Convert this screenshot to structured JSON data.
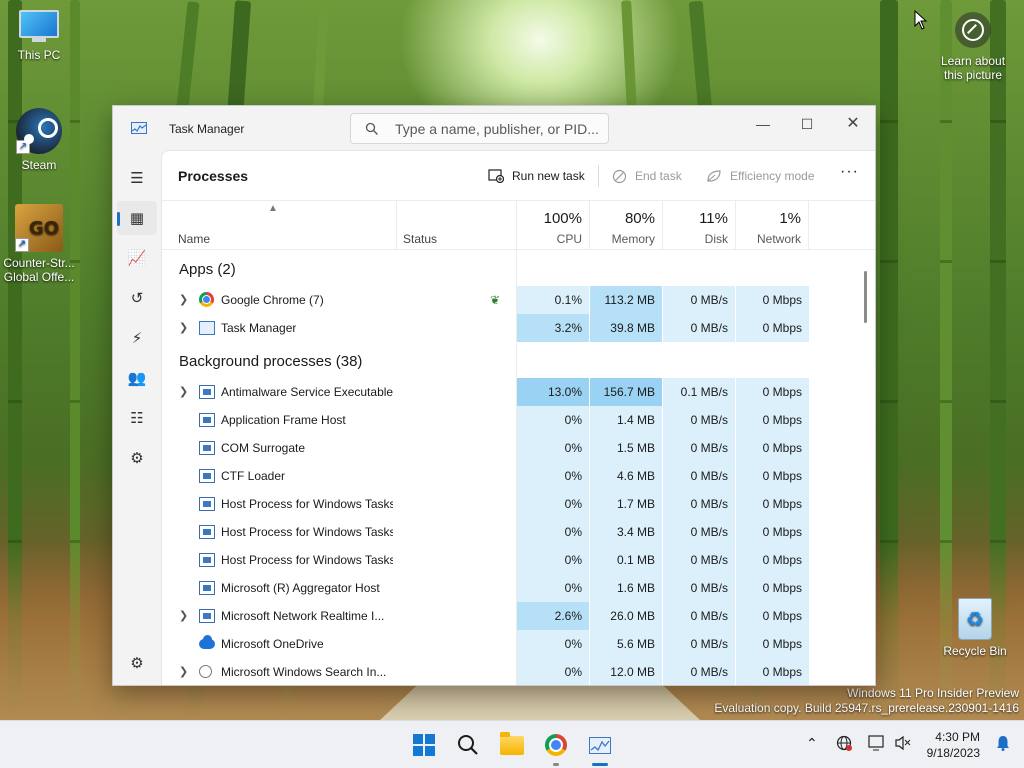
{
  "desktop": {
    "icons": [
      {
        "label": "This PC"
      },
      {
        "label": "Steam"
      },
      {
        "label": "Counter-Str... Global Offe..."
      },
      {
        "label": "Recycle Bin"
      }
    ],
    "cs_logo_text": "GO",
    "learn_label": "Learn about this picture",
    "watermark": {
      "line1": "Windows 11 Pro Insider Preview",
      "line2": "Evaluation copy. Build 25947.rs_prerelease.230901-1416"
    }
  },
  "window": {
    "title": "Task Manager",
    "search_placeholder": "Type a name, publisher, or PID...",
    "controls": {
      "minimize": "—",
      "maximize": "☐",
      "close": "✕"
    }
  },
  "rail": {
    "items": [
      {
        "name": "menu-icon",
        "glyph": "☰"
      },
      {
        "name": "processes-icon",
        "glyph": "▦"
      },
      {
        "name": "performance-icon",
        "glyph": "📈"
      },
      {
        "name": "app-history-icon",
        "glyph": "↺"
      },
      {
        "name": "startup-apps-icon",
        "glyph": "⚡"
      },
      {
        "name": "users-icon",
        "glyph": "👥"
      },
      {
        "name": "details-icon",
        "glyph": "☷"
      },
      {
        "name": "services-icon",
        "glyph": "⚙"
      }
    ],
    "settings_glyph": "⚙"
  },
  "toolbar": {
    "page_title": "Processes",
    "run_new_task": "Run new task",
    "end_task": "End task",
    "efficiency_mode": "Efficiency mode",
    "more": "···"
  },
  "columns": {
    "name": "Name",
    "status": "Status",
    "cpu": {
      "pct": "100%",
      "label": "CPU"
    },
    "memory": {
      "pct": "80%",
      "label": "Memory"
    },
    "disk": {
      "pct": "11%",
      "label": "Disk"
    },
    "network": {
      "pct": "1%",
      "label": "Network"
    }
  },
  "groups": [
    {
      "label": "Apps (2)",
      "rows": [
        {
          "name": "Google Chrome (7)",
          "icon": "chrome-icon",
          "expandable": true,
          "efficiency": true,
          "cpu": "0.1%",
          "mem": "113.2 MB",
          "disk": "0 MB/s",
          "net": "0 Mbps",
          "cpu_h": "h1",
          "mem_h": "h2"
        },
        {
          "name": "Task Manager",
          "icon": "task-manager-icon",
          "expandable": true,
          "efficiency": false,
          "cpu": "3.2%",
          "mem": "39.8 MB",
          "disk": "0 MB/s",
          "net": "0 Mbps",
          "cpu_h": "h2",
          "mem_h": "h2"
        }
      ]
    },
    {
      "label": "Background processes (38)",
      "rows": [
        {
          "name": "Antimalware Service Executable",
          "icon": "process-icon",
          "expandable": true,
          "efficiency": false,
          "cpu": "13.0%",
          "mem": "156.7 MB",
          "disk": "0.1 MB/s",
          "net": "0 Mbps",
          "cpu_h": "h3",
          "mem_h": "h3"
        },
        {
          "name": "Application Frame Host",
          "icon": "process-icon",
          "expandable": false,
          "efficiency": false,
          "cpu": "0%",
          "mem": "1.4 MB",
          "disk": "0 MB/s",
          "net": "0 Mbps",
          "cpu_h": "h1",
          "mem_h": "h1"
        },
        {
          "name": "COM Surrogate",
          "icon": "process-icon",
          "expandable": false,
          "efficiency": false,
          "cpu": "0%",
          "mem": "1.5 MB",
          "disk": "0 MB/s",
          "net": "0 Mbps",
          "cpu_h": "h1",
          "mem_h": "h1"
        },
        {
          "name": "CTF Loader",
          "icon": "process-icon",
          "expandable": false,
          "efficiency": false,
          "cpu": "0%",
          "mem": "4.6 MB",
          "disk": "0 MB/s",
          "net": "0 Mbps",
          "cpu_h": "h1",
          "mem_h": "h1"
        },
        {
          "name": "Host Process for Windows Tasks",
          "icon": "process-icon",
          "expandable": false,
          "efficiency": false,
          "cpu": "0%",
          "mem": "1.7 MB",
          "disk": "0 MB/s",
          "net": "0 Mbps",
          "cpu_h": "h1",
          "mem_h": "h1"
        },
        {
          "name": "Host Process for Windows Tasks",
          "icon": "process-icon",
          "expandable": false,
          "efficiency": false,
          "cpu": "0%",
          "mem": "3.4 MB",
          "disk": "0 MB/s",
          "net": "0 Mbps",
          "cpu_h": "h1",
          "mem_h": "h1"
        },
        {
          "name": "Host Process for Windows Tasks",
          "icon": "process-icon",
          "expandable": false,
          "efficiency": false,
          "cpu": "0%",
          "mem": "0.1 MB",
          "disk": "0 MB/s",
          "net": "0 Mbps",
          "cpu_h": "h1",
          "mem_h": "h1"
        },
        {
          "name": "Microsoft (R) Aggregator Host",
          "icon": "process-icon",
          "expandable": false,
          "efficiency": false,
          "cpu": "0%",
          "mem": "1.6 MB",
          "disk": "0 MB/s",
          "net": "0 Mbps",
          "cpu_h": "h1",
          "mem_h": "h1"
        },
        {
          "name": "Microsoft Network Realtime I...",
          "icon": "process-icon",
          "expandable": true,
          "efficiency": false,
          "cpu": "2.6%",
          "mem": "26.0 MB",
          "disk": "0 MB/s",
          "net": "0 Mbps",
          "cpu_h": "h2",
          "mem_h": "h1"
        },
        {
          "name": "Microsoft OneDrive",
          "icon": "onedrive-icon",
          "expandable": false,
          "efficiency": false,
          "cpu": "0%",
          "mem": "5.6 MB",
          "disk": "0 MB/s",
          "net": "0 Mbps",
          "cpu_h": "h1",
          "mem_h": "h1"
        },
        {
          "name": "Microsoft Windows Search In...",
          "icon": "search-indexer-icon",
          "expandable": true,
          "efficiency": false,
          "cpu": "0%",
          "mem": "12.0 MB",
          "disk": "0 MB/s",
          "net": "0 Mbps",
          "cpu_h": "h1",
          "mem_h": "h1"
        }
      ]
    }
  ],
  "taskbar": {
    "apps": [
      {
        "name": "start-button"
      },
      {
        "name": "search-button"
      },
      {
        "name": "file-explorer-button"
      },
      {
        "name": "chrome-button"
      },
      {
        "name": "task-manager-button"
      }
    ],
    "clock": {
      "time": "4:30 PM",
      "date": "9/18/2023"
    }
  },
  "colors": {
    "accent": "#1a6fc6",
    "heat_light": "#dbf0fb",
    "heat_mid": "#b5e0f7",
    "heat_strong": "#9ad2f3"
  }
}
